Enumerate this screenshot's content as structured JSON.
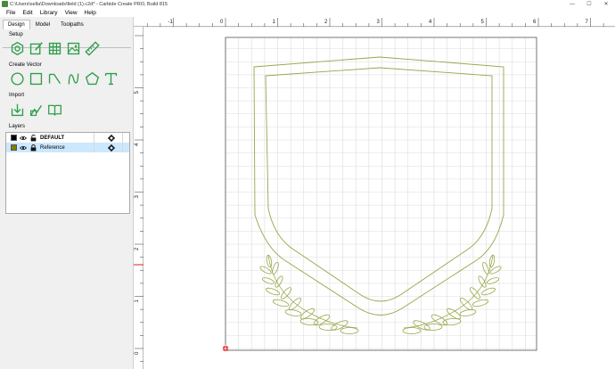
{
  "window": {
    "title": "C:\\Users\\sella\\Downloads\\field (1).c2d* - Carbide Create PRO, Build 815",
    "minimize": "—",
    "maximize": "☐",
    "close": "✕"
  },
  "menu": [
    "File",
    "Edit",
    "Library",
    "View",
    "Help"
  ],
  "tabs": [
    "Design",
    "Model",
    "Toolpaths"
  ],
  "sections": {
    "setup": "Setup",
    "create_vector": "Create Vector",
    "import": "Import",
    "layers": "Layers"
  },
  "setup_tools": [
    "job-setup-icon",
    "edit-document-icon",
    "grid-icon",
    "image-icon",
    "ruler-icon"
  ],
  "vector_tools": [
    "circle-icon",
    "rectangle-icon",
    "polyline-icon",
    "curve-icon",
    "polygon-icon",
    "text-icon"
  ],
  "import_tools": [
    "import-vector-icon",
    "import-image-icon",
    "open-library-icon"
  ],
  "layers": [
    {
      "name": "DEFAULT",
      "color": "#000000",
      "bold": true,
      "selected": false
    },
    {
      "name": "Reference",
      "color": "#808000",
      "bold": false,
      "selected": true
    }
  ],
  "ruler": {
    "x_labels": [
      "-1",
      "0",
      "1",
      "2",
      "3",
      "4",
      "5",
      "6",
      "7"
    ],
    "y_labels": [
      "5",
      "4",
      "3",
      "2",
      "1",
      "0"
    ]
  },
  "colors": {
    "accent": "#2e9e4a",
    "vector_stroke": "#9aa54a",
    "grid": "#d4d4d4",
    "origin": "#e02020",
    "selection": "#cce8ff"
  }
}
